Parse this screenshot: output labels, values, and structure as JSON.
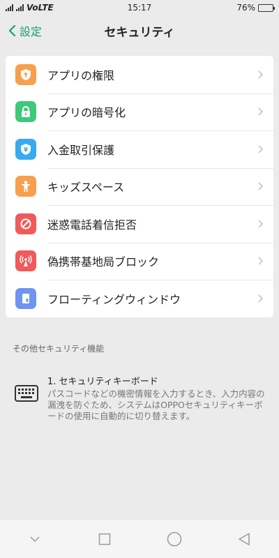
{
  "status_bar": {
    "network": "VoLTE",
    "time": "15:17",
    "battery_text": "76%",
    "battery_level": 0.76
  },
  "header": {
    "back_label": "設定",
    "title": "セキュリティ"
  },
  "colors": {
    "accent": "#17a06b",
    "orange": "#f6a04d",
    "green": "#3dc87a",
    "blue": "#39a9f0",
    "red": "#f05a5a",
    "purple": "#6f93f0"
  },
  "menu": {
    "items": [
      {
        "label": "アプリの権限",
        "icon": "shield-key-icon"
      },
      {
        "label": "アプリの暗号化",
        "icon": "lock-icon"
      },
      {
        "label": "入金取引保護",
        "icon": "yen-shield-icon"
      },
      {
        "label": "キッズスペース",
        "icon": "child-icon"
      },
      {
        "label": "迷惑電話着信拒否",
        "icon": "block-icon"
      },
      {
        "label": "偽携帯基地局ブロック",
        "icon": "antenna-icon"
      },
      {
        "label": "フローティングウィンドウ",
        "icon": "floating-window-icon"
      }
    ]
  },
  "other": {
    "section_title": "その他セキュリティ機能",
    "keyboard_title": "1. セキュリティキーボード",
    "keyboard_desc": "パスコードなどの機密情報を入力するとき、入力内容の漏洩を防ぐため、システムはOPPOセキュリティキーボードの使用に自動的に切り替えます。"
  }
}
